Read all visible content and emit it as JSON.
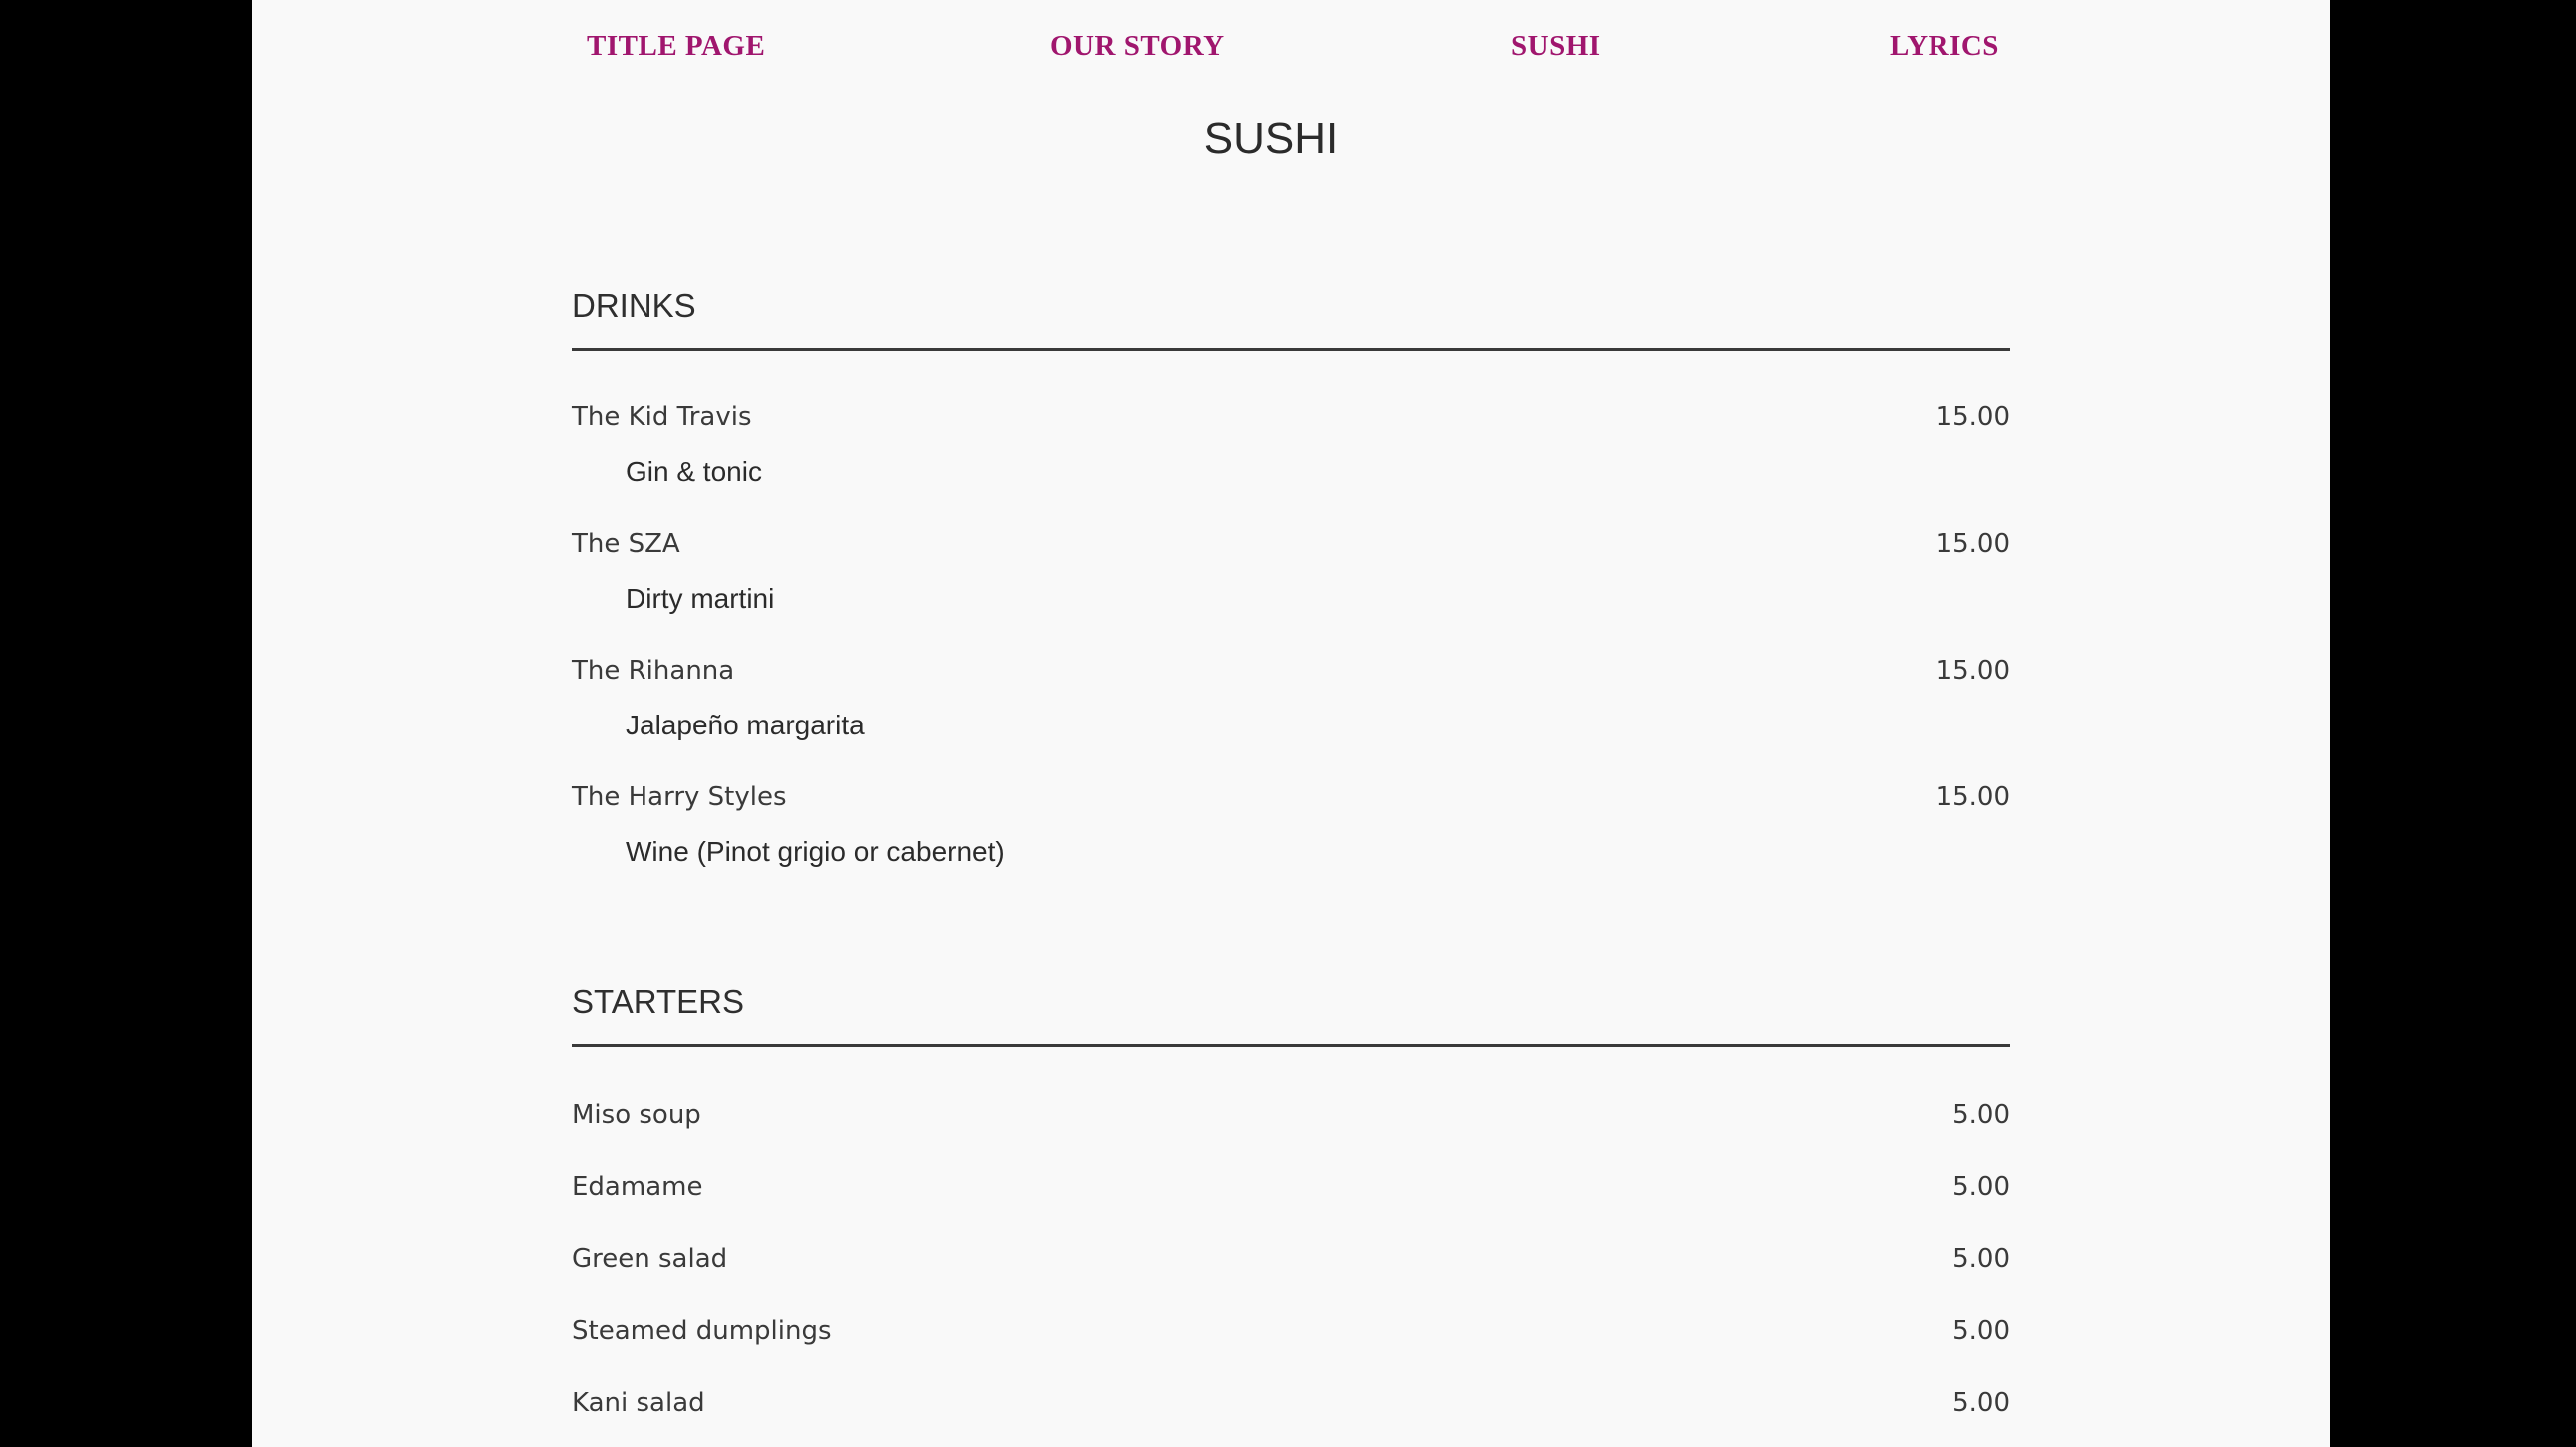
{
  "nav": [
    "TITLE PAGE",
    "OUR STORY",
    "SUSHI",
    "LYRICS"
  ],
  "page_title": "SUSHI",
  "drinks": {
    "title": "DRINKS",
    "items": [
      {
        "name": "The Kid Travis",
        "price": "15.00",
        "desc": "Gin & tonic"
      },
      {
        "name": "The SZA",
        "price": "15.00",
        "desc": "Dirty martini"
      },
      {
        "name": "The Rihanna",
        "price": "15.00",
        "desc": "Jalapeño margarita"
      },
      {
        "name": "The Harry Styles",
        "price": "15.00",
        "desc": "Wine (Pinot grigio or cabernet)"
      }
    ]
  },
  "starters": {
    "title": "STARTERS",
    "items": [
      {
        "name": "Miso soup",
        "price": "5.00"
      },
      {
        "name": "Edamame",
        "price": "5.00"
      },
      {
        "name": "Green salad",
        "price": "5.00"
      },
      {
        "name": "Steamed dumplings",
        "price": "5.00"
      },
      {
        "name": "Kani salad",
        "price": "5.00"
      }
    ]
  },
  "colors": {
    "nav_link": "#a0166e",
    "page_bg": "#f9f9f9",
    "outer_bg": "#000000"
  }
}
